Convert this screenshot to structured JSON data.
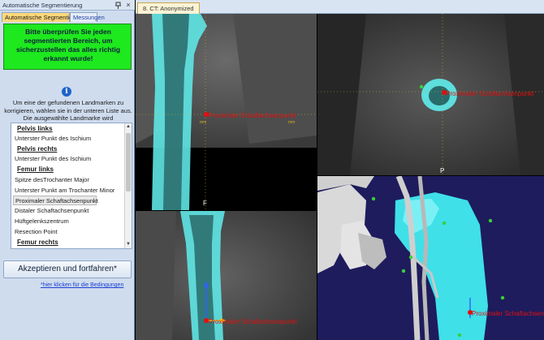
{
  "panel": {
    "title": "Automatische Segmentierung",
    "pin_icon": "pin-icon",
    "close_icon": "close-icon",
    "close_glyph": "×",
    "tabs": [
      {
        "label": "Automatische Segmentierung",
        "active": true
      },
      {
        "label": "Messungen",
        "active": false
      }
    ],
    "status_message": "Bitte überprüfen Sie jeden segmentierten Bereich, um sicherzustellen das alles richtig erkannt wurde!",
    "status_color": "#1ee81e",
    "info_icon": "info-icon",
    "info_glyph": "i",
    "info_text": "Um eine der gefundenen Landmarken zu korrigieren, wählen sie in der unteren Liste aus. Die ausgewählte Landmarke wird",
    "landmarks": [
      {
        "label": "Pelvis links",
        "type": "header"
      },
      {
        "label": "Unterster Punkt des Ischium",
        "type": "item"
      },
      {
        "label": "Pelvis rechts",
        "type": "header"
      },
      {
        "label": "Unterster Punkt des Ischium",
        "type": "item"
      },
      {
        "label": "Femur links",
        "type": "header"
      },
      {
        "label": "Spitze desTrochanter Major",
        "type": "item"
      },
      {
        "label": "Unterster Punkt am Trochanter Minor",
        "type": "item"
      },
      {
        "label": "Proximaler Schaftachsenpunkt",
        "type": "item",
        "selected": true
      },
      {
        "label": "Distaler Schaftachsenpunkt",
        "type": "item"
      },
      {
        "label": "Hüftgelenkszentrum",
        "type": "item"
      },
      {
        "label": "Resection Point",
        "type": "item"
      },
      {
        "label": "Femur rechts",
        "type": "header"
      }
    ],
    "accept_button": "Akzeptieren und fortfahren*",
    "terms_link": "*hier klicken für die Bedingungen"
  },
  "viewer": {
    "document_tab": "8. CT: Anonymized",
    "landmark_label": "Proximaler Schaftachsenpunkt",
    "mm_label": "mm",
    "orientation_labels": {
      "coronal_bottom": "F",
      "axial_bottom": "P"
    },
    "colors": {
      "segmentation": "#5fe6e6",
      "landmark": "#e01010",
      "crosshair": "#d8b020",
      "marker": "#38d038",
      "background_3d": "#1e1c5c"
    }
  }
}
